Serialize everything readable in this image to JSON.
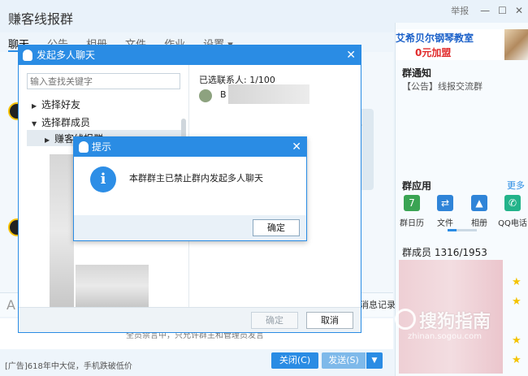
{
  "window": {
    "group_name": "赚客线报群",
    "report": "举报",
    "min": "—",
    "max": "☐",
    "close": "✕"
  },
  "tabs": [
    "聊天",
    "公告",
    "相册",
    "文件",
    "作业",
    "设置 ▾"
  ],
  "chat": {
    "bubble_glyph": "F",
    "font_icon": "A",
    "history": "消息记录 ▾",
    "input_hint": "全员禁言中，只允许群主和管理员发言",
    "ad_text": "[广告]618年中大促，手机跌破低价",
    "close_button": "关闭(C)",
    "send_button": "发送(S)",
    "send_arrow": "▼"
  },
  "right_panel": {
    "ad_line1": "艾希贝尔钢琴教室",
    "ad_line2": "0元加盟",
    "notice_title": "群通知",
    "notice_text": "【公告】线报交流群",
    "apps_title": "群应用",
    "apps_more": "更多",
    "apps": [
      {
        "label": "群日历",
        "icon": "calendar-icon",
        "color": "#3aa453",
        "glyph": "7"
      },
      {
        "label": "文件",
        "icon": "file-icon",
        "color": "#2f84d8",
        "glyph": "⇄"
      },
      {
        "label": "相册",
        "icon": "photo-icon",
        "color": "#2f84d8",
        "glyph": "▲"
      },
      {
        "label": "QQ电话",
        "icon": "phone-icon",
        "color": "#23b38a",
        "glyph": "✆"
      }
    ],
    "members_label": "群成员 1316/1953",
    "star": "★"
  },
  "multi_chat_dialog": {
    "title": "发起多人聊天",
    "close": "✕",
    "search_placeholder": "输入查找关键字",
    "tree": [
      {
        "label": "选择好友",
        "caret": "▶"
      },
      {
        "label": "选择群成员",
        "caret": "▼"
      },
      {
        "label": "赚客线报群",
        "caret": "▶"
      }
    ],
    "selected_label": "已选联系人: 1/100",
    "selected_name": "B",
    "ok": "确定",
    "cancel": "取消"
  },
  "alert_dialog": {
    "title": "提示",
    "close": "✕",
    "info_glyph": "i",
    "message": "本群群主已禁止群内发起多人聊天",
    "ok": "确定"
  },
  "watermark": {
    "text": "搜狗指南",
    "sub": "zhinan.sogou.com"
  }
}
